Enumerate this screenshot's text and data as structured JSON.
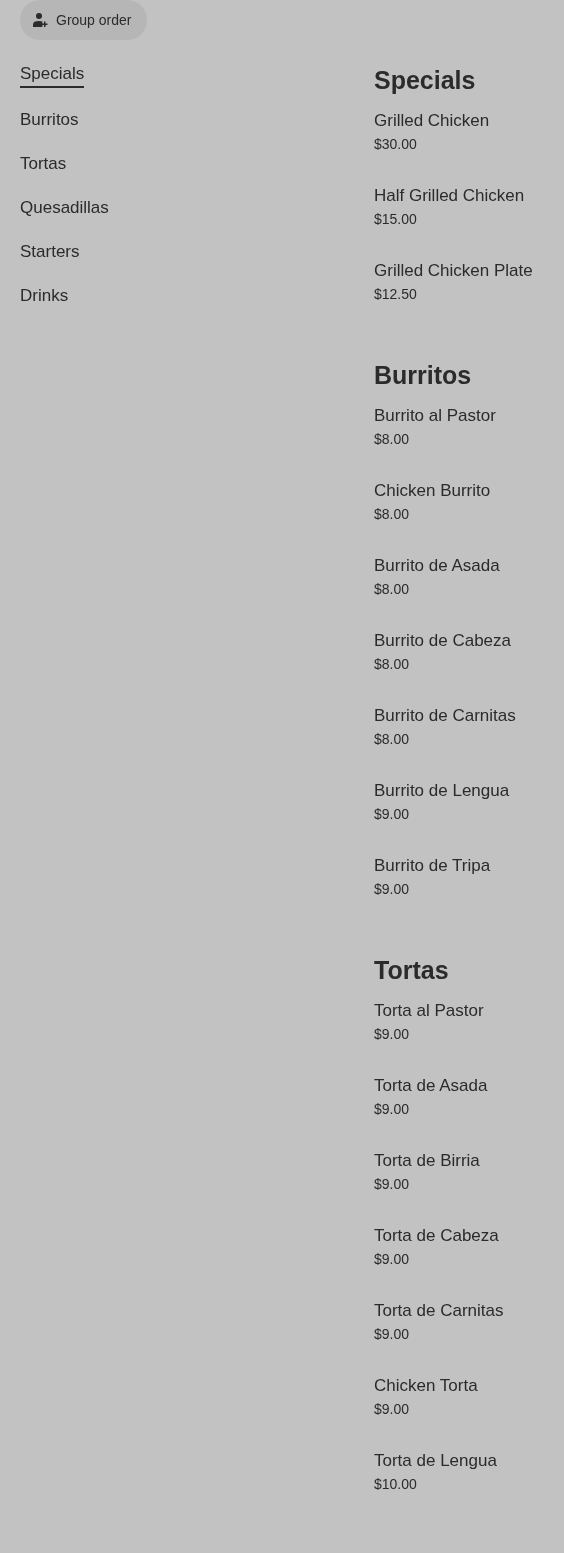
{
  "group_order_button": {
    "label": "Group order"
  },
  "nav": [
    {
      "label": "Specials",
      "selected": true
    },
    {
      "label": "Burritos",
      "selected": false
    },
    {
      "label": "Tortas",
      "selected": false
    },
    {
      "label": "Quesadillas",
      "selected": false
    },
    {
      "label": "Starters",
      "selected": false
    },
    {
      "label": "Drinks",
      "selected": false
    }
  ],
  "sections": [
    {
      "title": "Specials",
      "items": [
        {
          "name": "Grilled Chicken",
          "price": "$30.00"
        },
        {
          "name": "Half Grilled Chicken",
          "price": "$15.00"
        },
        {
          "name": "Grilled Chicken Plate",
          "price": "$12.50"
        }
      ]
    },
    {
      "title": "Burritos",
      "items": [
        {
          "name": "Burrito al Pastor",
          "price": "$8.00"
        },
        {
          "name": "Chicken Burrito",
          "price": "$8.00"
        },
        {
          "name": "Burrito de Asada",
          "price": "$8.00"
        },
        {
          "name": "Burrito de Cabeza",
          "price": "$8.00"
        },
        {
          "name": "Burrito de Carnitas",
          "price": "$8.00"
        },
        {
          "name": "Burrito de Lengua",
          "price": "$9.00"
        },
        {
          "name": "Burrito de Tripa",
          "price": "$9.00"
        }
      ]
    },
    {
      "title": "Tortas",
      "items": [
        {
          "name": "Torta al Pastor",
          "price": "$9.00"
        },
        {
          "name": "Torta de Asada",
          "price": "$9.00"
        },
        {
          "name": "Torta de Birria",
          "price": "$9.00"
        },
        {
          "name": "Torta de Cabeza",
          "price": "$9.00"
        },
        {
          "name": "Torta de Carnitas",
          "price": "$9.00"
        },
        {
          "name": "Chicken Torta",
          "price": "$9.00"
        },
        {
          "name": "Torta de Lengua",
          "price": "$10.00"
        }
      ]
    }
  ]
}
